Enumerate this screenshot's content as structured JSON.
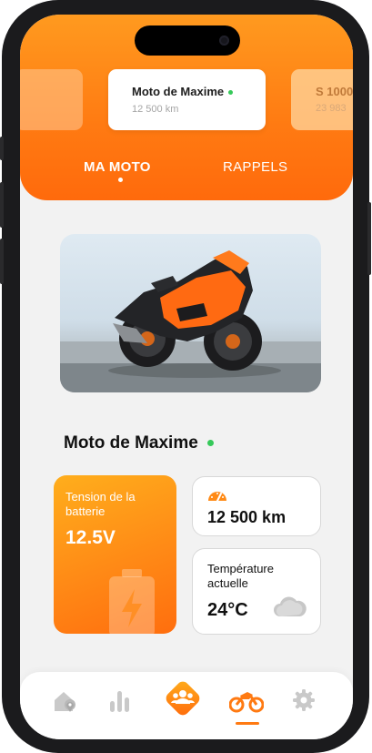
{
  "carousel": {
    "prev_card": {
      "name": "",
      "km": ""
    },
    "current_card": {
      "name": "Moto de Maxime",
      "km": "12 500 km"
    },
    "next_card": {
      "name": "S 1000",
      "km": "23 983"
    }
  },
  "tabs": {
    "my_bike": "MA MOTO",
    "reminders": "RAPPELS"
  },
  "bike": {
    "name": "Moto de Maxime",
    "status_color": "#36c95a"
  },
  "battery": {
    "label": "Tension de la batterie",
    "value": "12.5V"
  },
  "odometer": {
    "value": "12 500 km",
    "icon": "speedometer-icon"
  },
  "temperature": {
    "label": "Température actuelle",
    "value": "24°C",
    "icon": "cloud-icon"
  },
  "nav": {
    "items": [
      "home-location-icon",
      "stats-icon",
      "group-icon",
      "motorcycle-icon",
      "settings-icon"
    ],
    "active": "motorcycle-icon"
  },
  "colors": {
    "accent": "#ff7a12",
    "accent_light": "#ffae1c",
    "status": "#36c95a"
  }
}
